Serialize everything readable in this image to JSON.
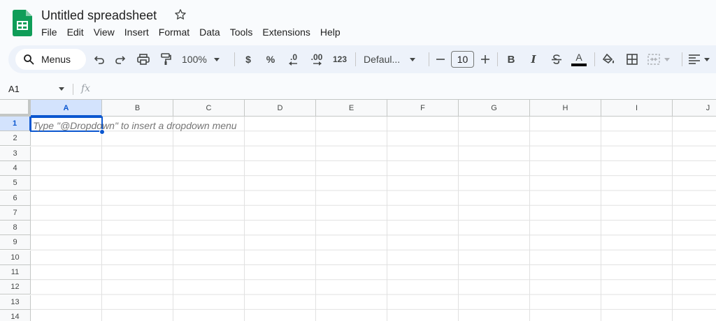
{
  "doc": {
    "title": "Untitled spreadsheet"
  },
  "menu": [
    "File",
    "Edit",
    "View",
    "Insert",
    "Format",
    "Data",
    "Tools",
    "Extensions",
    "Help"
  ],
  "toolbar": {
    "menus_label": "Menus",
    "zoom": "100%",
    "currency": "$",
    "percent": "%",
    "decrease_decimal": ".0",
    "increase_decimal": ".00",
    "number_format": "123",
    "font_family": "Defaul...",
    "font_size": "10",
    "bold": "B",
    "italic": "I",
    "text_color_glyph": "A"
  },
  "formula_bar": {
    "cell_ref": "A1",
    "fx": "fx"
  },
  "columns": [
    "A",
    "B",
    "C",
    "D",
    "E",
    "F",
    "G",
    "H",
    "I",
    "J"
  ],
  "rows": [
    "1",
    "2",
    "3",
    "4",
    "5",
    "6",
    "7",
    "8",
    "9",
    "10",
    "11",
    "12",
    "13",
    "14"
  ],
  "cells": {
    "A1_hint": "Type \"@Dropdown\"  to insert a dropdown menu"
  },
  "colors": {
    "accent": "#0b57d0",
    "sheets_green": "#0f9d58",
    "selected_header": "#d3e3fd"
  }
}
